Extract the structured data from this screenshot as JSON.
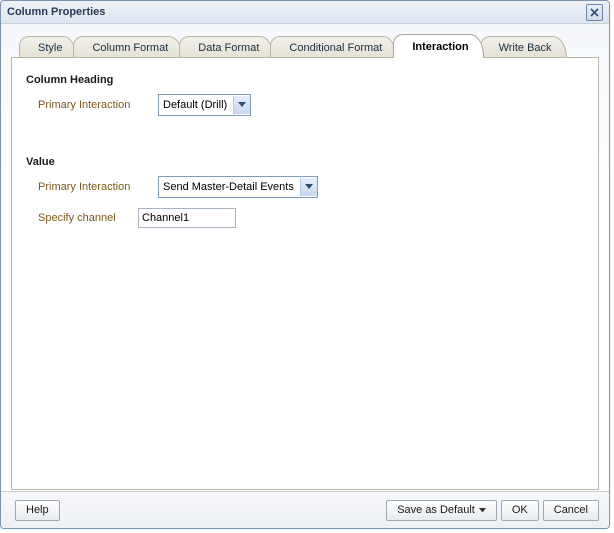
{
  "dialog": {
    "title": "Column Properties"
  },
  "tabs": {
    "style": "Style",
    "column_format": "Column Format",
    "data_format": "Data Format",
    "conditional_format": "Conditional Format",
    "interaction": "Interaction",
    "write_back": "Write Back"
  },
  "sections": {
    "column_heading": {
      "title": "Column Heading",
      "primary_interaction_label": "Primary Interaction",
      "primary_interaction_value": "Default (Drill)"
    },
    "value": {
      "title": "Value",
      "primary_interaction_label": "Primary Interaction",
      "primary_interaction_value": "Send Master-Detail Events",
      "specify_channel_label": "Specify channel",
      "specify_channel_value": "Channel1"
    }
  },
  "footer": {
    "help": "Help",
    "save_as_default": "Save as Default",
    "ok": "OK",
    "cancel": "Cancel"
  }
}
